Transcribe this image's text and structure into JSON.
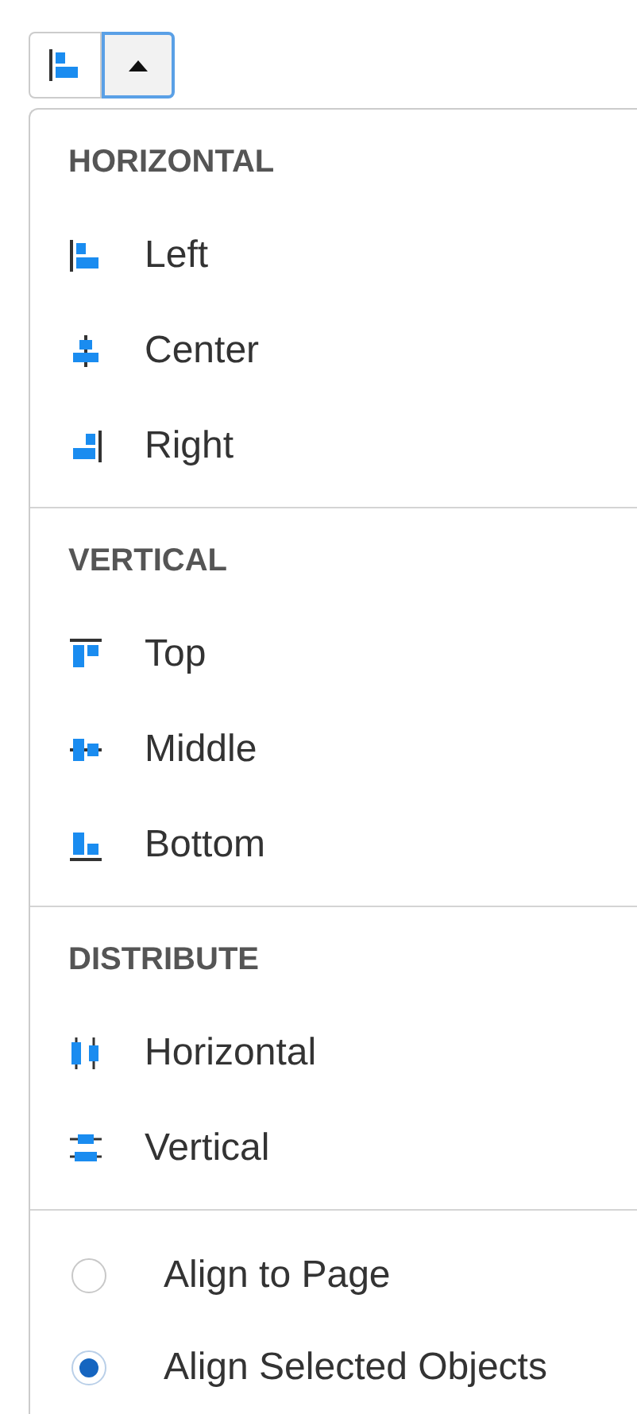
{
  "toolbar": {
    "button": {
      "kind": "left"
    },
    "dropdown_expanded": true
  },
  "sections": [
    {
      "heading": "HORIZONTAL",
      "items": [
        {
          "label": "Left",
          "kind": "left"
        },
        {
          "label": "Center",
          "kind": "center"
        },
        {
          "label": "Right",
          "kind": "right"
        }
      ]
    },
    {
      "heading": "VERTICAL",
      "items": [
        {
          "label": "Top",
          "kind": "top"
        },
        {
          "label": "Middle",
          "kind": "middle"
        },
        {
          "label": "Bottom",
          "kind": "bottom"
        }
      ]
    },
    {
      "heading": "DISTRIBUTE",
      "items": [
        {
          "label": "Horizontal",
          "kind": "hspread"
        },
        {
          "label": "Vertical",
          "kind": "vspread"
        }
      ]
    }
  ],
  "align_to": [
    {
      "label": "Align to Page",
      "selected": false
    },
    {
      "label": "Align Selected Objects",
      "selected": true
    }
  ]
}
